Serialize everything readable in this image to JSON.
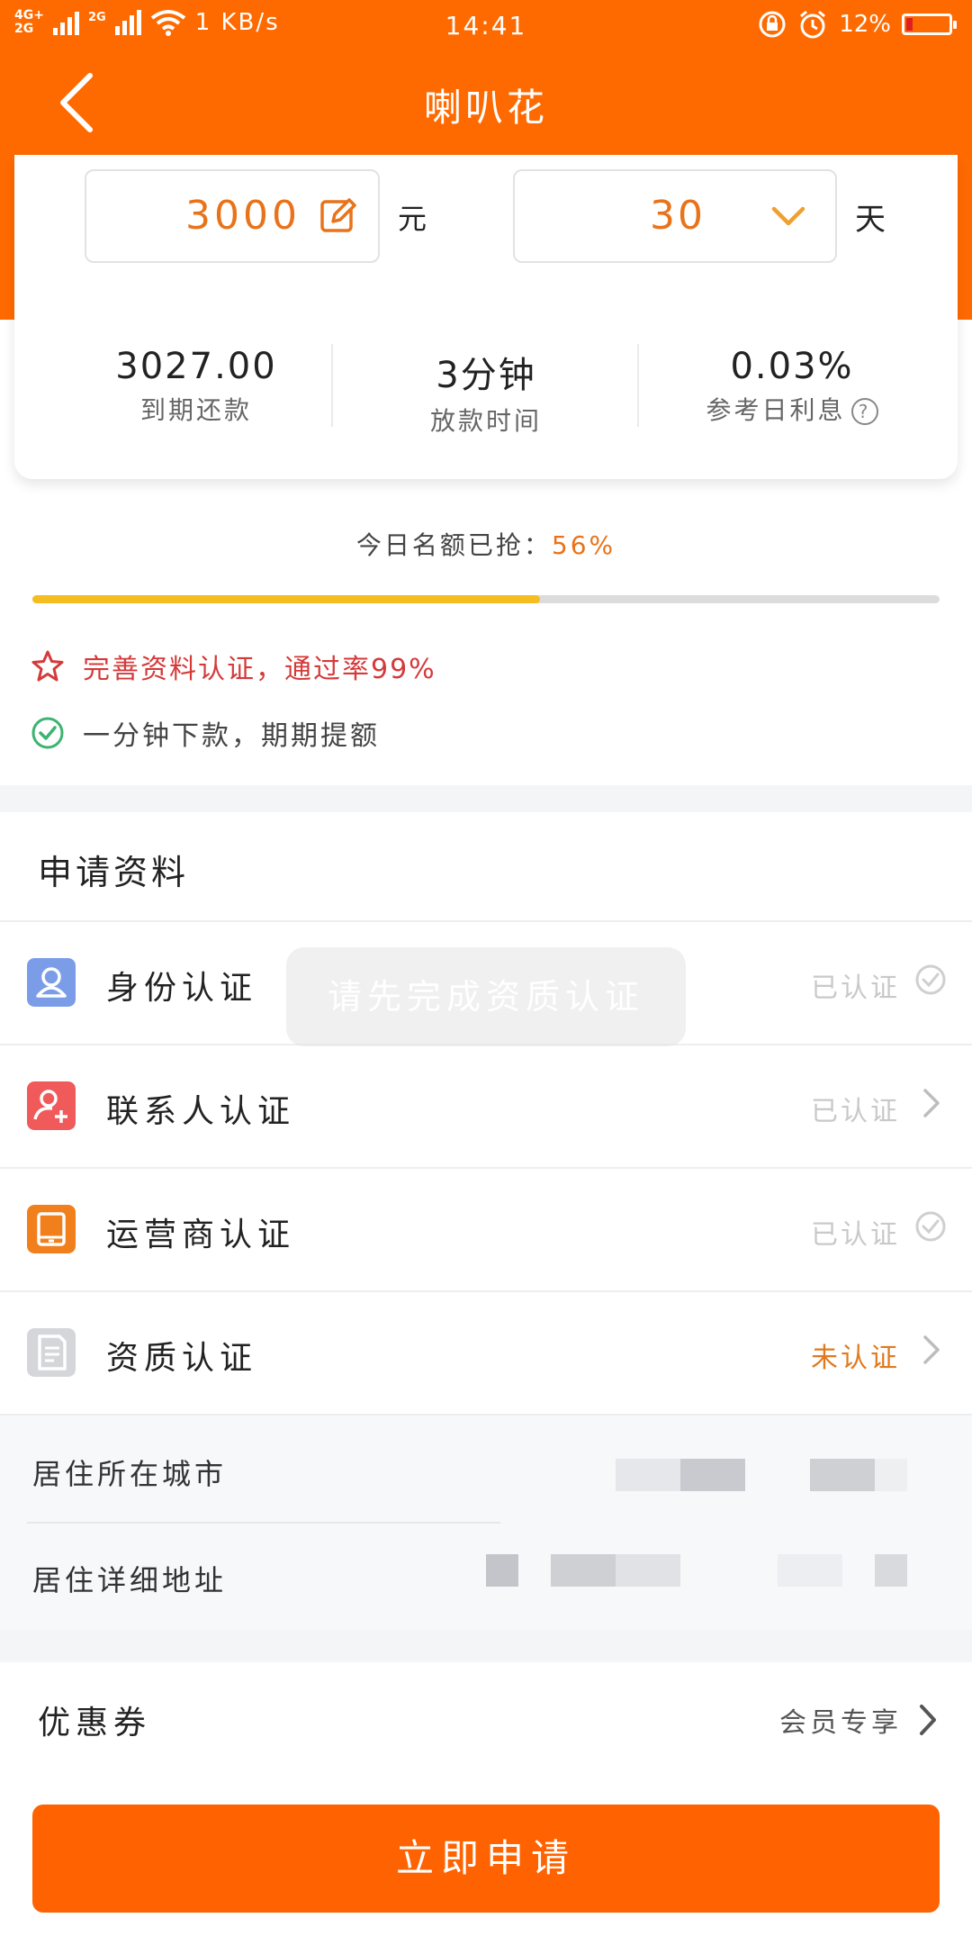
{
  "status_bar": {
    "network_left": "4G+",
    "network_left2": "2G",
    "network_small": "2G",
    "speed": "1 KB/s",
    "time": "14:41",
    "battery": "12%"
  },
  "nav": {
    "title": "喇叭花"
  },
  "loan": {
    "amount": "3000",
    "amount_unit": "元",
    "term": "30",
    "term_unit": "天",
    "stats": [
      {
        "value": "3027.00",
        "label": "到期还款"
      },
      {
        "value": "3分钟",
        "label": "放款时间"
      },
      {
        "value": "0.03%",
        "label": "参考日利息"
      }
    ]
  },
  "quota": {
    "label": "今日名额已抢：",
    "percent": "56%",
    "progress_fraction": 0.56
  },
  "tips": {
    "tip1": "完善资料认证，通过率99%",
    "tip2": "一分钟下款，期期提额"
  },
  "application": {
    "section_title": "申请资料",
    "items": [
      {
        "label": "身份认证",
        "status": "已认证",
        "icon": "id-user-icon",
        "color": "#7b9de8"
      },
      {
        "label": "联系人认证",
        "status": "已认证",
        "icon": "contact-add-icon",
        "color": "#f05a5a"
      },
      {
        "label": "运营商认证",
        "status": "已认证",
        "icon": "tablet-icon",
        "color": "#f07f1c"
      },
      {
        "label": "资质认证",
        "status": "未认证",
        "icon": "document-icon",
        "color": "#d4d6da"
      }
    ],
    "city_label": "居住所在城市",
    "address_label": "居住详细地址"
  },
  "coupon": {
    "label": "优惠券",
    "value": "会员专享"
  },
  "apply_button": "立即申请",
  "toast": "请先完成资质认证",
  "colors": {
    "brand": "#ff6a00",
    "accent_text": "#e8731a",
    "warn": "#d53a3a",
    "ok": "#3cb371"
  }
}
